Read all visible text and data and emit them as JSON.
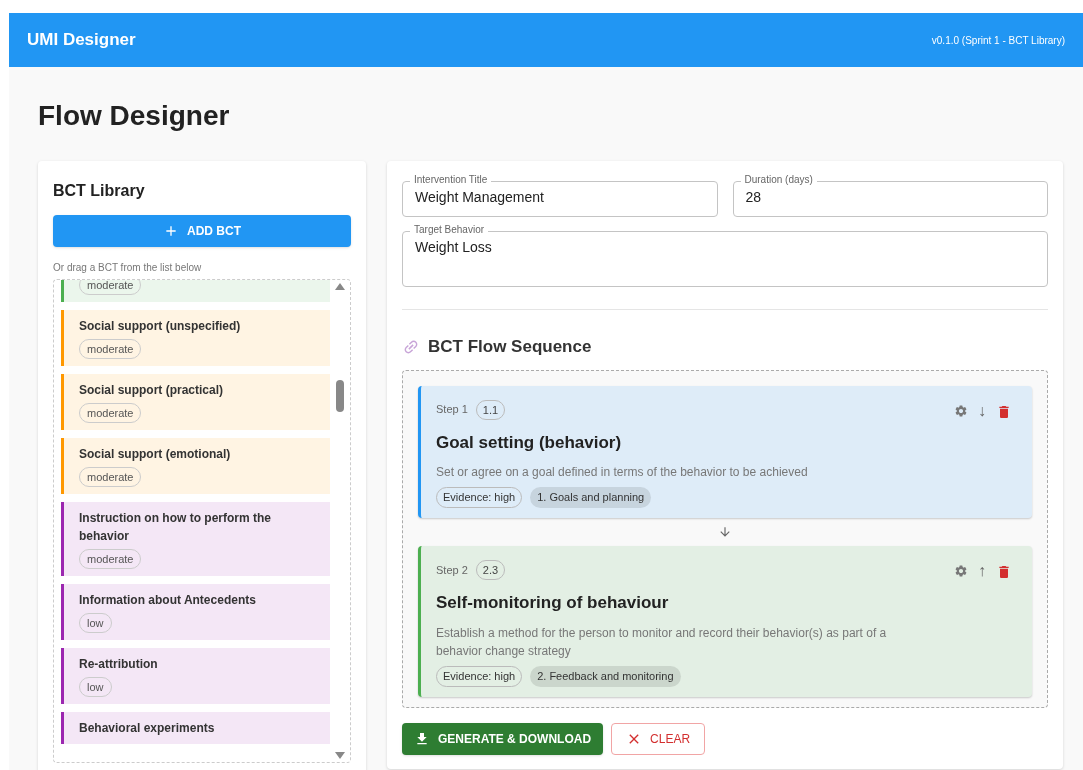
{
  "app_bar": {
    "title": "UMI Designer",
    "version": "v0.1.0 (Sprint 1 - BCT Library)"
  },
  "page_title": "Flow Designer",
  "library": {
    "title": "BCT Library",
    "add_button": "ADD BCT",
    "hint": "Or drag a BCT from the list below",
    "items": [
      {
        "evidence": "moderate",
        "color": "#4caf50"
      },
      {
        "name": "Social support (unspecified)",
        "evidence": "moderate",
        "color": "#ff9800"
      },
      {
        "name": "Social support (practical)",
        "evidence": "moderate",
        "color": "#ff9800"
      },
      {
        "name": "Social support (emotional)",
        "evidence": "moderate",
        "color": "#ff9800"
      },
      {
        "name": "Instruction on how to perform the behavior",
        "evidence": "moderate",
        "color": "#9c27b0"
      },
      {
        "name": "Information about Antecedents",
        "evidence": "low",
        "color": "#9c27b0"
      },
      {
        "name": "Re-attribution",
        "evidence": "low",
        "color": "#9c27b0"
      },
      {
        "name": "Behavioral experiments",
        "color": "#9c27b0"
      }
    ]
  },
  "form": {
    "fields": [
      {
        "label": "Intervention Title",
        "value": "Weight Management"
      },
      {
        "label": "Duration (days)",
        "value": "28"
      }
    ],
    "target": {
      "label": "Target Behavior",
      "value": "Weight Loss"
    }
  },
  "flow": {
    "title": "BCT Flow Sequence",
    "steps": [
      {
        "step": "Step 1",
        "code": "1.1",
        "title": "Goal setting (behavior)",
        "description": "Set or agree on a goal defined in terms of the behavior to be achieved",
        "evidence": "Evidence: high",
        "category": "1. Goals and planning",
        "color": "#2196f3",
        "move": "↓"
      },
      {
        "step": "Step 2",
        "code": "2.3",
        "title": "Self-monitoring of behaviour",
        "description": "Establish a method for the person to monitor and record their behavior(s) as part of a behavior change strategy",
        "evidence": "Evidence: high",
        "category": "2. Feedback and monitoring",
        "color": "#4caf50",
        "move": "↑"
      }
    ]
  },
  "actions": {
    "generate": "GENERATE & DOWNLOAD",
    "clear": "CLEAR"
  }
}
